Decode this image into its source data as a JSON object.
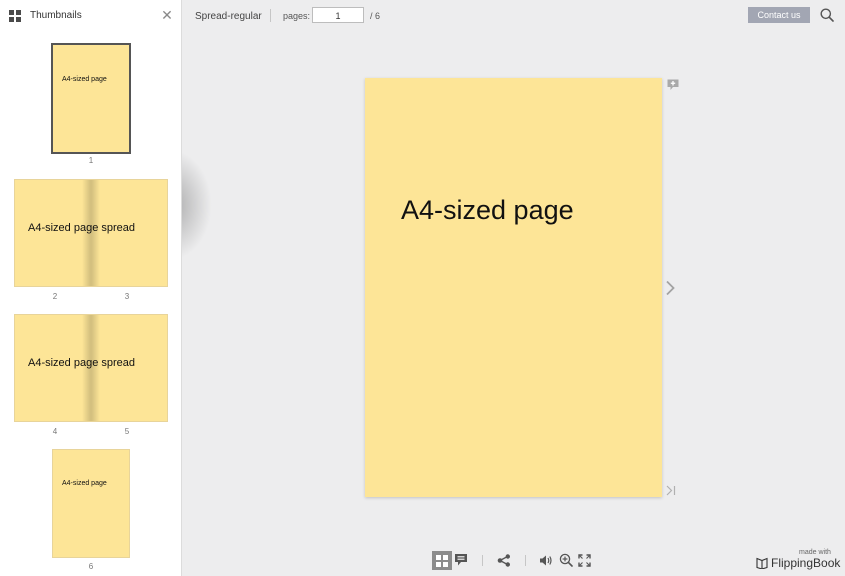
{
  "sidebar": {
    "title": "Thumbnails",
    "thumbnails": [
      {
        "text": "A4-sized page",
        "numbers": [
          "1"
        ],
        "selected": true
      },
      {
        "text": "A4-sized page spread",
        "numbers": [
          "2",
          "3"
        ]
      },
      {
        "text": "A4-sized page spread",
        "numbers": [
          "4",
          "5"
        ]
      },
      {
        "text": "A4-sized page",
        "numbers": [
          "6"
        ]
      }
    ]
  },
  "topbar": {
    "doc_title": "Spread-regular",
    "pages_label": "pages:",
    "current_page": "1",
    "total_pages": "/ 6",
    "contact_label": "Contact us"
  },
  "main": {
    "page_text": "A4-sized page"
  },
  "branding": {
    "made_with": "made with",
    "name": "FlippingBook"
  },
  "colors": {
    "page": "#fde597",
    "accent_button": "#a2a6b3",
    "background": "#ededee"
  },
  "icons": [
    "grid-icon",
    "close-icon",
    "search-icon",
    "add-note-icon",
    "chevron-right-icon",
    "last-page-icon",
    "thumbnails-icon",
    "notes-icon",
    "share-icon",
    "sound-icon",
    "zoom-in-icon",
    "fullscreen-icon",
    "flippingbook-logo-icon"
  ]
}
